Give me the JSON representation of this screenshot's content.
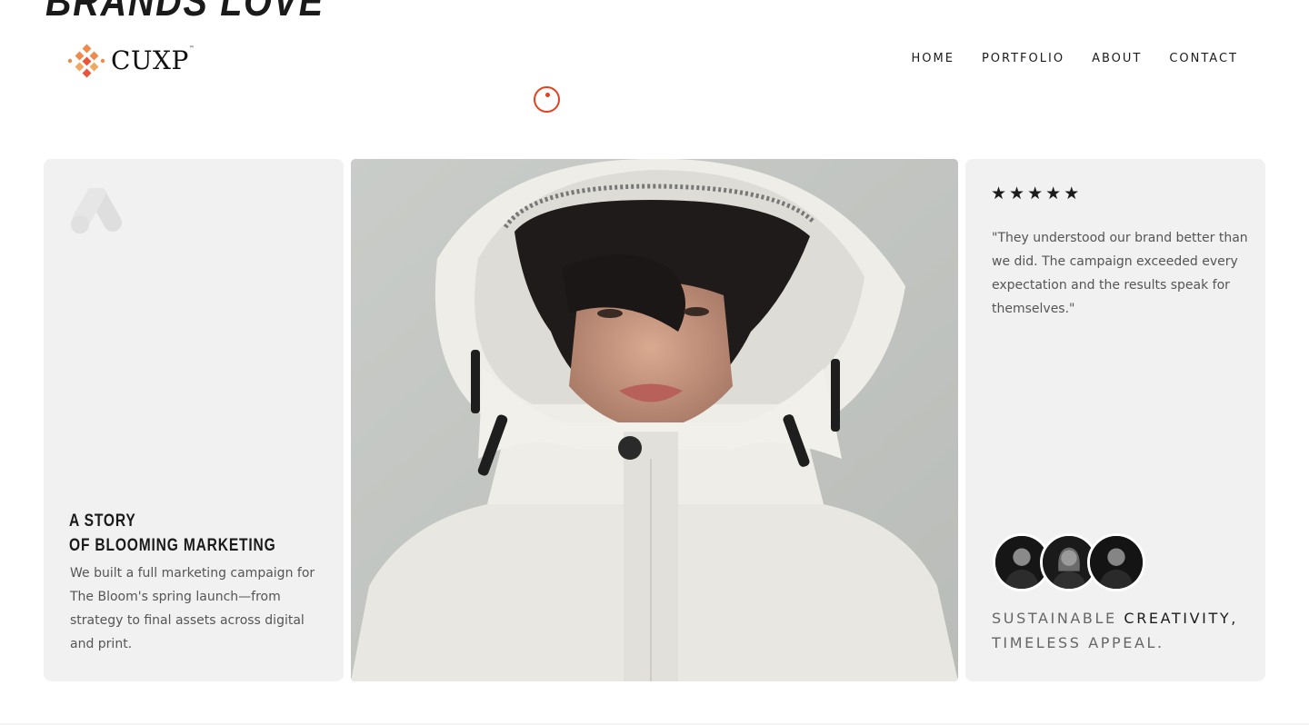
{
  "hero": {
    "heading": "BRANDS LOVE"
  },
  "brand": {
    "logo_text": "CUXP",
    "trademark": "™"
  },
  "nav": {
    "items": [
      "HOME",
      "PORTFOLIO",
      "ABOUT",
      "CONTACT"
    ]
  },
  "story_card": {
    "icon": "google-ads-icon",
    "title_line1": "A STORY",
    "title_line2": "OF BLOOMING MARKETING",
    "description": "We built a full marketing campaign for The Bloom's spring launch—from strategy to final assets across digital and print."
  },
  "feature_image": {
    "subject": "portrait-white-hooded-jacket"
  },
  "testimonial_card": {
    "rating": 5,
    "stars": [
      "★",
      "★",
      "★",
      "★",
      "★"
    ],
    "quote": "\"They understood our brand better than we did. The campaign exceeded every expectation and the results speak for themselves.\"",
    "avatars": [
      "team-member-1",
      "team-member-2",
      "team-member-3"
    ],
    "tagline_part1": "SUSTAINABLE",
    "tagline_part2": "CREATIVITY,",
    "tagline_part3": "TIMELESS APPEAL."
  },
  "colors": {
    "accent": "#e8401c",
    "card_bg": "#f1f1f1",
    "text_dark": "#1c1c1c",
    "text_muted": "#555555"
  }
}
